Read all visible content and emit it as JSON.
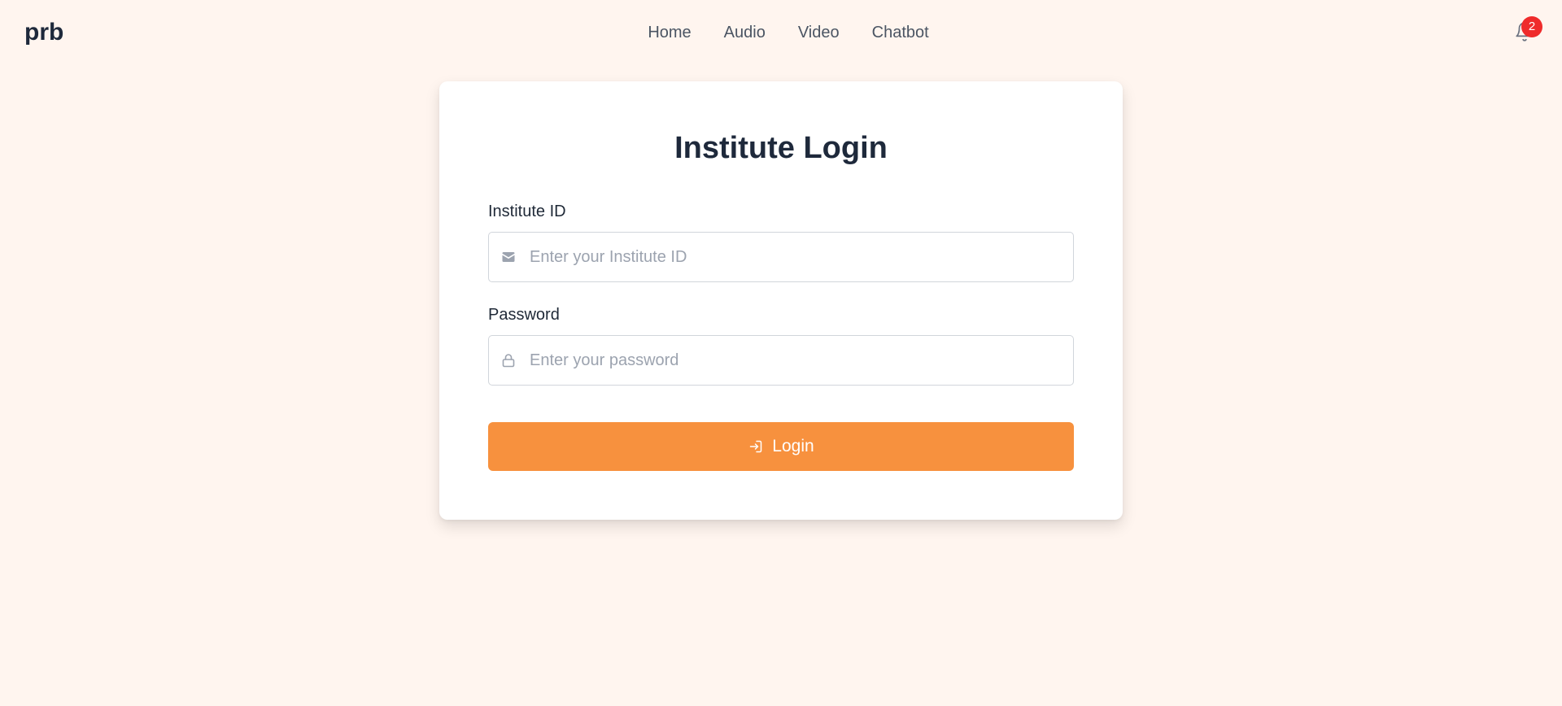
{
  "header": {
    "brand": "prb",
    "nav": [
      {
        "label": "Home"
      },
      {
        "label": "Audio"
      },
      {
        "label": "Video"
      },
      {
        "label": "Chatbot"
      }
    ],
    "notifications": {
      "icon": "bell-icon",
      "count": "2"
    }
  },
  "login": {
    "title": "Institute Login",
    "institute_id": {
      "label": "Institute ID",
      "placeholder": "Enter your Institute ID",
      "value": "",
      "icon": "envelope-icon"
    },
    "password": {
      "label": "Password",
      "placeholder": "Enter your password",
      "value": "",
      "icon": "lock-icon"
    },
    "submit": {
      "label": "Login",
      "icon": "login-arrow-icon"
    }
  },
  "colors": {
    "background": "#fff5ef",
    "accent": "#f7913e",
    "badge": "#ef2b2b",
    "text": "#1e293b"
  }
}
